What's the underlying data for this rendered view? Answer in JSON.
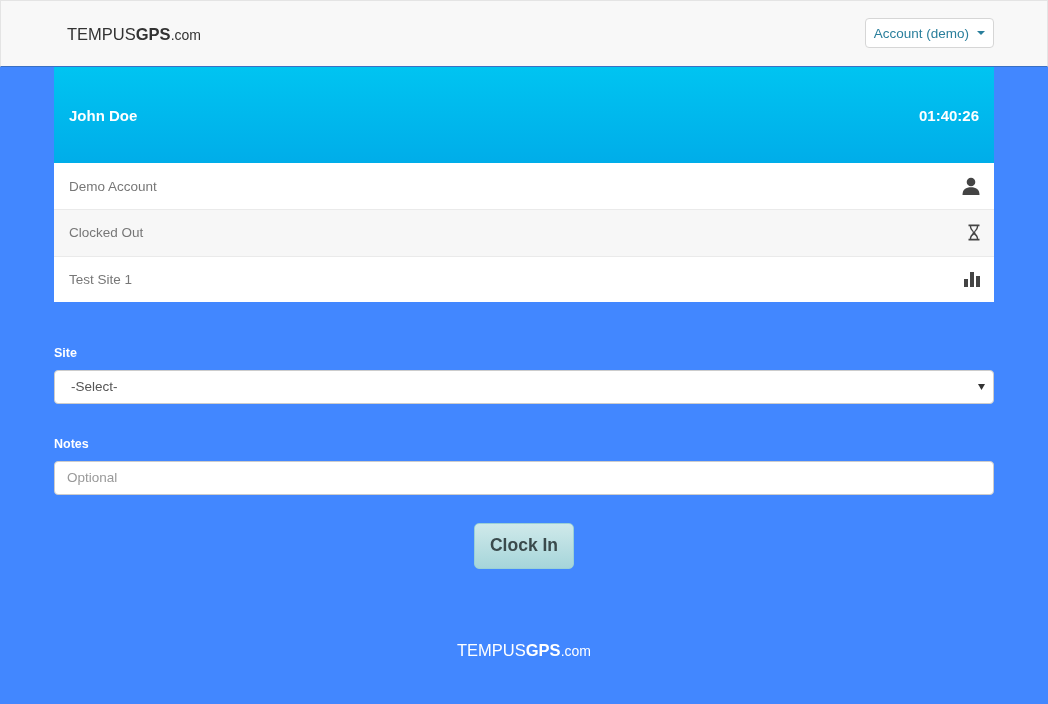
{
  "navbar": {
    "logo": {
      "brand": "TEMPUS",
      "highlight": "GPS",
      "domain": ".com"
    },
    "account_menu": {
      "label": "Account (demo)",
      "expanded": false
    }
  },
  "status_card": {
    "name": "John Doe",
    "time": "01:40:26",
    "rows": [
      {
        "text": "Demo Account",
        "kind": "person"
      },
      {
        "text": "Clocked Out",
        "kind": "hourglass"
      },
      {
        "text": "Test Site 1",
        "kind": "chart"
      }
    ]
  },
  "form": {
    "site": {
      "label": "Site",
      "value": "-Select-"
    },
    "notes": {
      "label": "Notes",
      "placeholder": "Optional"
    },
    "submit": "Clock In"
  },
  "footer": {
    "logo": {
      "brand": "TEMPUS",
      "highlight": "GPS",
      "domain": ".com"
    }
  }
}
